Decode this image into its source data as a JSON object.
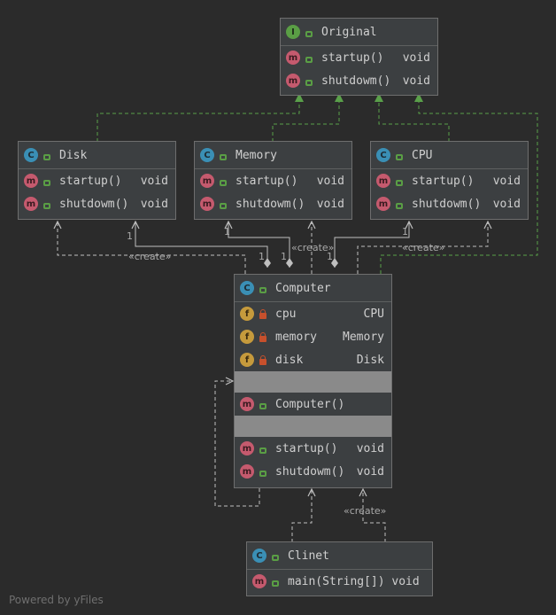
{
  "nodes": {
    "original": {
      "title": "Original",
      "kind": "I",
      "methods": [
        {
          "name": "startup()",
          "type": "void"
        },
        {
          "name": "shutdowm()",
          "type": "void"
        }
      ]
    },
    "disk": {
      "title": "Disk",
      "kind": "C",
      "methods": [
        {
          "name": "startup()",
          "type": "void"
        },
        {
          "name": "shutdowm()",
          "type": "void"
        }
      ]
    },
    "memory": {
      "title": "Memory",
      "kind": "C",
      "methods": [
        {
          "name": "startup()",
          "type": "void"
        },
        {
          "name": "shutdowm()",
          "type": "void"
        }
      ]
    },
    "cpu": {
      "title": "CPU",
      "kind": "C",
      "methods": [
        {
          "name": "startup()",
          "type": "void"
        },
        {
          "name": "shutdowm()",
          "type": "void"
        }
      ]
    },
    "computer": {
      "title": "Computer",
      "kind": "C",
      "fields": [
        {
          "name": "cpu",
          "type": "CPU"
        },
        {
          "name": "memory",
          "type": "Memory"
        },
        {
          "name": "disk",
          "type": "Disk"
        }
      ],
      "constructor": {
        "name": "Computer()"
      },
      "methods": [
        {
          "name": "startup()",
          "type": "void"
        },
        {
          "name": "shutdowm()",
          "type": "void"
        }
      ]
    },
    "clinet": {
      "title": "Clinet",
      "kind": "C",
      "methods": [
        {
          "name": "main(String[]) void"
        }
      ]
    }
  },
  "icon_letters": {
    "class": "C",
    "interface": "I",
    "method": "m",
    "field": "f"
  },
  "labels": {
    "create_disk": "«create»",
    "create_memory": "«create»",
    "create_cpu": "«create»",
    "create_clinet": "«create»",
    "mult_disk": "1",
    "mult_disk2": "1",
    "mult_memory": "1",
    "mult_memory2": "1",
    "mult_cpu": "1",
    "mult_cpu2": "1"
  },
  "watermark": "Powered by yFiles",
  "colors": {
    "background": "#2b2b2b",
    "node": "#3c3f41",
    "realization": "#5aa04a",
    "dependency": "#bfbfbf"
  }
}
